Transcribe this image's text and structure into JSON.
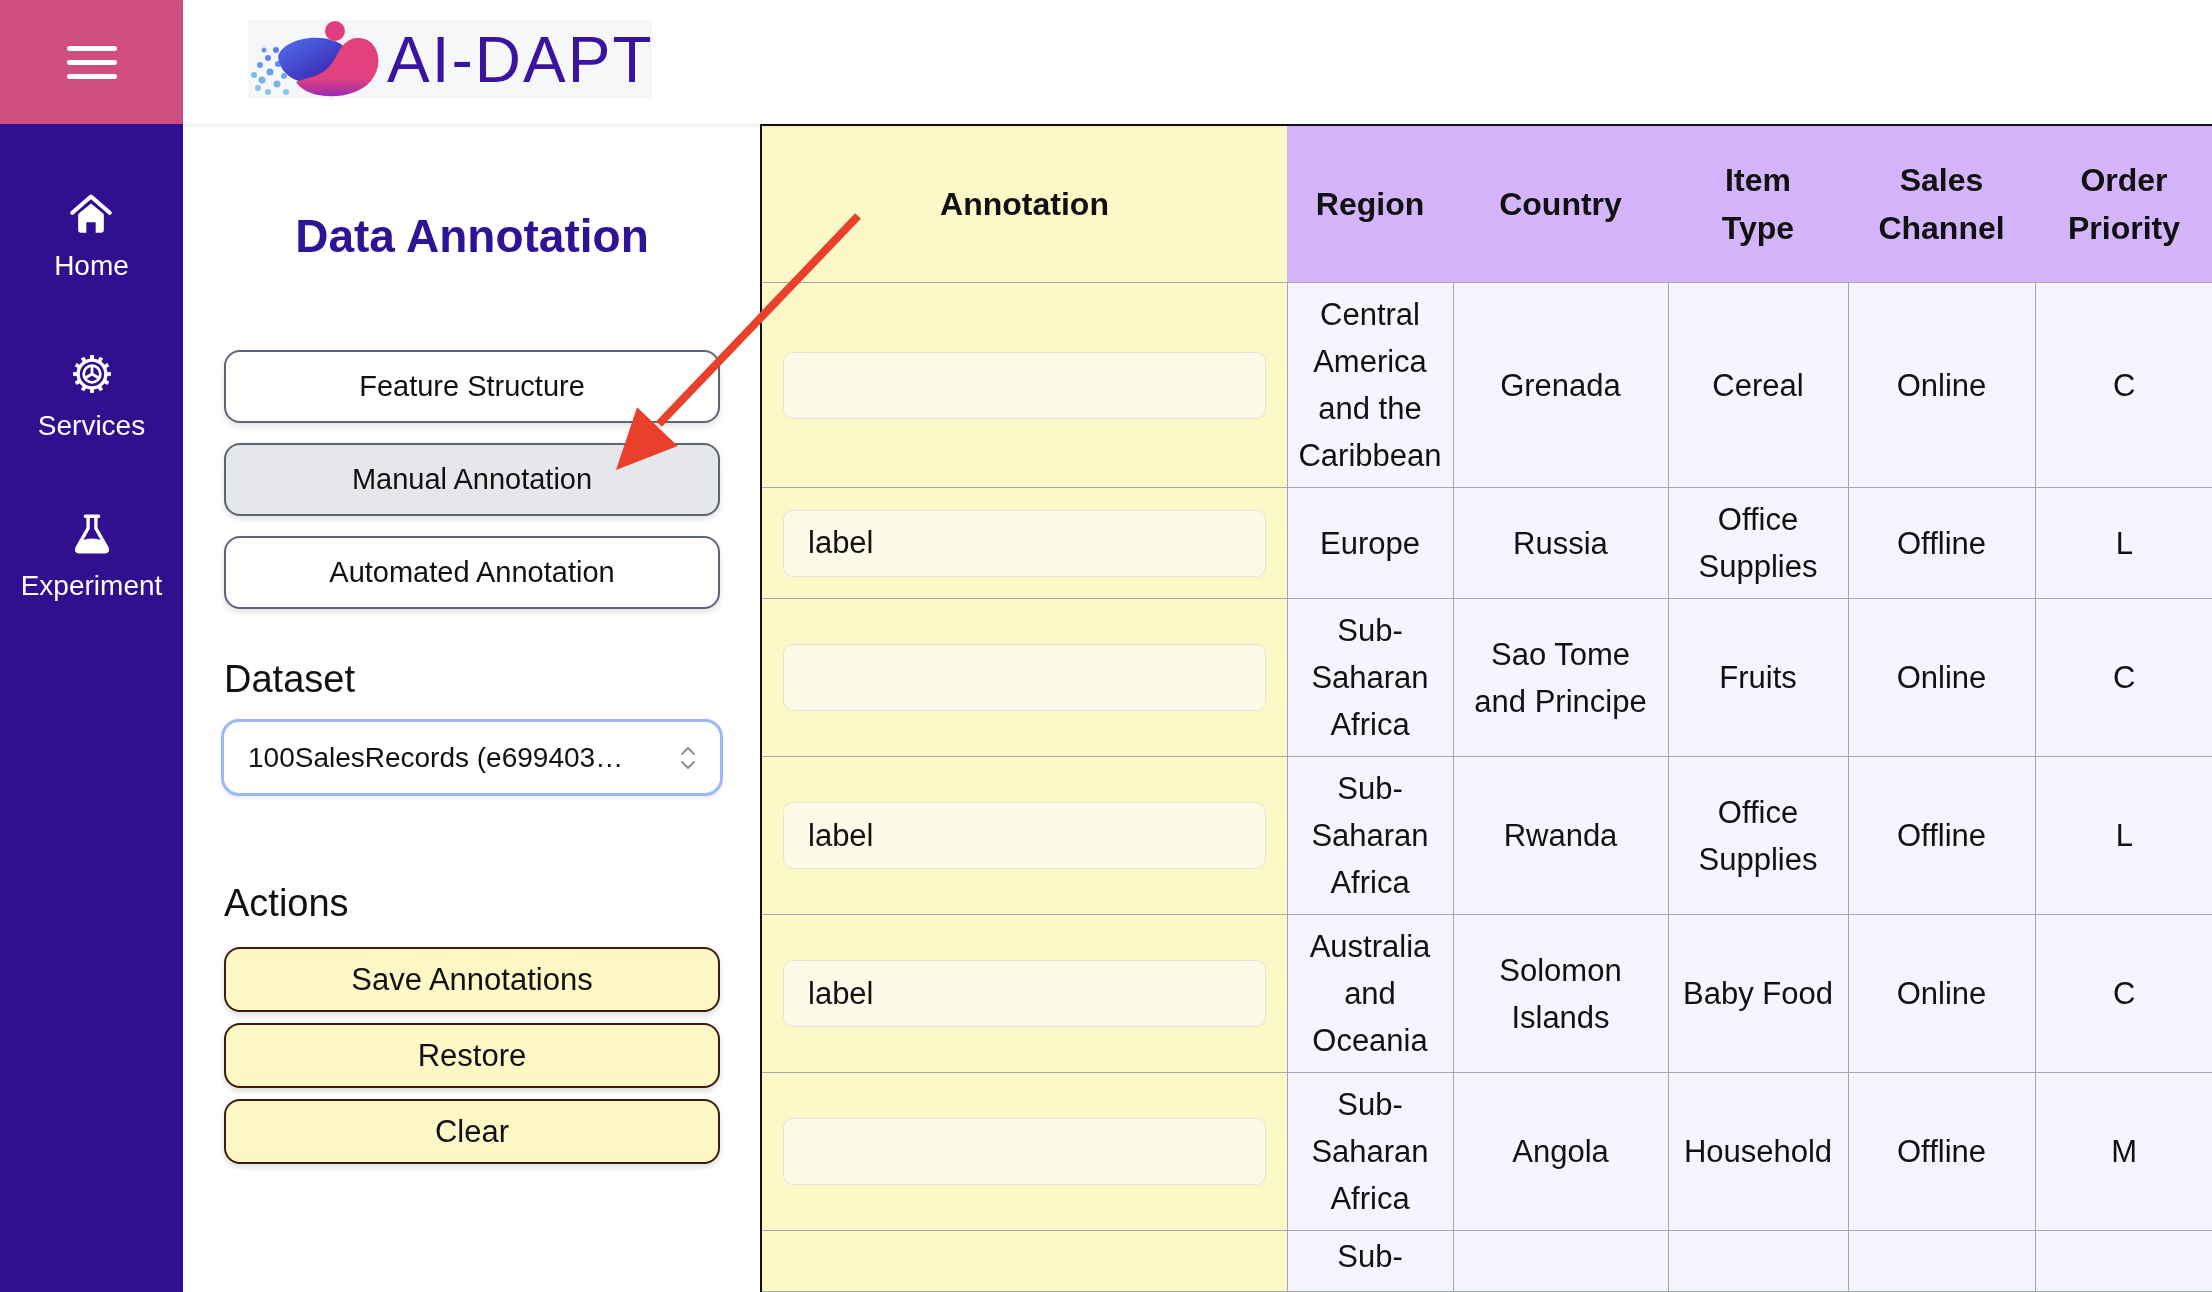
{
  "sidebar": {
    "items": [
      {
        "label": "Home"
      },
      {
        "label": "Services"
      },
      {
        "label": "Experiment"
      }
    ]
  },
  "header": {
    "logo_text": "AI-DAPT"
  },
  "panel": {
    "title": "Data Annotation",
    "modes": [
      {
        "label": "Feature Structure",
        "selected": false
      },
      {
        "label": "Manual Annotation",
        "selected": true
      },
      {
        "label": "Automated Annotation",
        "selected": false
      }
    ],
    "dataset": {
      "label": "Dataset",
      "value": "100SalesRecords (e699403…"
    },
    "actions": {
      "label": "Actions",
      "buttons": [
        "Save Annotations",
        "Restore",
        "Clear"
      ]
    }
  },
  "table": {
    "columns": [
      "Annotation",
      "Region",
      "Country",
      "Item Type",
      "Sales Channel",
      "Order Priority"
    ],
    "rows": [
      {
        "cells": [
          "",
          "Central America and the Caribbean",
          "Grenada",
          "Cereal",
          "Online",
          "C"
        ]
      },
      {
        "cells": [
          "label",
          "Europe",
          "Russia",
          "Office Supplies",
          "Offline",
          "L"
        ]
      },
      {
        "cells": [
          "",
          "Sub-Saharan Africa",
          "Sao Tome and Principe",
          "Fruits",
          "Online",
          "C"
        ]
      },
      {
        "cells": [
          "label",
          "Sub-Saharan Africa",
          "Rwanda",
          "Office Supplies",
          "Offline",
          "L"
        ]
      },
      {
        "cells": [
          "label",
          "Australia and Oceania",
          "Solomon Islands",
          "Baby Food",
          "Online",
          "C"
        ]
      },
      {
        "cells": [
          "",
          "Sub-Saharan Africa",
          "Angola",
          "Household",
          "Offline",
          "M"
        ]
      }
    ],
    "cut_off_row": {
      "cells": [
        "",
        "Sub-"
      ]
    }
  }
}
